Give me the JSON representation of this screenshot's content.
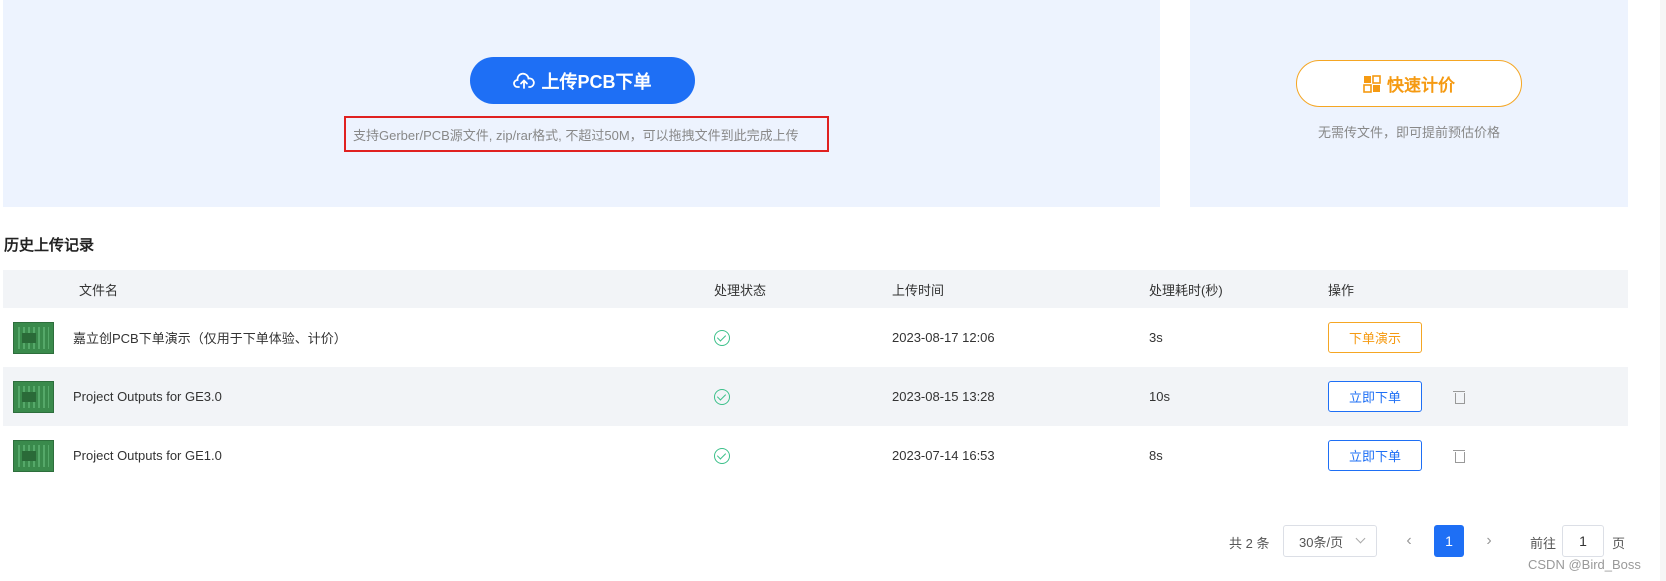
{
  "upload": {
    "button_label": "上传PCB下单",
    "hint": "支持Gerber/PCB源文件, zip/rar格式, 不超过50M，可以拖拽文件到此完成上传"
  },
  "quote": {
    "button_label": "快速计价",
    "hint": "无需传文件，即可提前预估价格"
  },
  "history": {
    "title": "历史上传记录",
    "columns": {
      "name": "文件名",
      "status": "处理状态",
      "time": "上传时间",
      "duration": "处理耗时(秒)",
      "action": "操作"
    },
    "rows": [
      {
        "name": "嘉立创PCB下单演示（仅用于下单体验、计价）",
        "status": "done",
        "time": "2023-08-17 12:06",
        "duration": "3s",
        "action": "下单演示",
        "deletable": false
      },
      {
        "name": "Project Outputs for GE3.0",
        "status": "done",
        "time": "2023-08-15 13:28",
        "duration": "10s",
        "action": "立即下单",
        "deletable": true
      },
      {
        "name": "Project Outputs for GE1.0",
        "status": "done",
        "time": "2023-07-14 16:53",
        "duration": "8s",
        "action": "立即下单",
        "deletable": true
      }
    ]
  },
  "pagination": {
    "total": "共 2 条",
    "page_size": "30条/页",
    "prev": "‹",
    "current": "1",
    "next": "›",
    "goto_label": "前往",
    "goto_value": "1",
    "goto_suffix": "页"
  },
  "watermark": "CSDN @Bird_Boss",
  "colors": {
    "primary": "#1e6ff5",
    "accent_orange": "#f5a623",
    "panel_bg": "#edf3fe",
    "success": "#3cc08a",
    "highlight_border": "#e02020"
  }
}
